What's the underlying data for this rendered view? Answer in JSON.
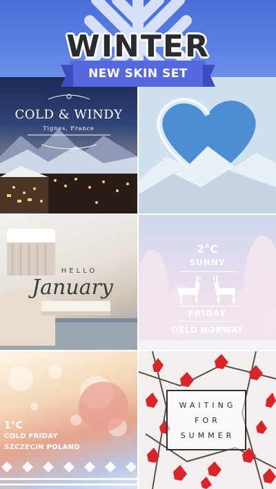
{
  "header": {
    "title": "WINTER",
    "subtitle": "NEW SKIN SET"
  },
  "tiles": [
    {
      "name": "cold-windy",
      "title": "COLD & WINDY",
      "subtitle": "Tignes, France"
    },
    {
      "name": "heart-mountain"
    },
    {
      "name": "hello-january",
      "line1": "HELLO",
      "line2": "January"
    },
    {
      "name": "oslo",
      "temp": "2°C",
      "condition": "SUNNY",
      "day": "FRIDAY",
      "city": "OSLO NORWAY"
    },
    {
      "name": "szczecin",
      "temp": "1°C",
      "line1": "COLD FRIDAY",
      "line2": "SZCZECIN POLAND"
    },
    {
      "name": "waiting-summer",
      "line1": "WAITING",
      "line2": "FOR",
      "line3": "SUMMER"
    }
  ],
  "colors": {
    "header_blue": "#5a80e4",
    "ribbon": "#5767dd",
    "leaf_red": "#d8252a"
  }
}
